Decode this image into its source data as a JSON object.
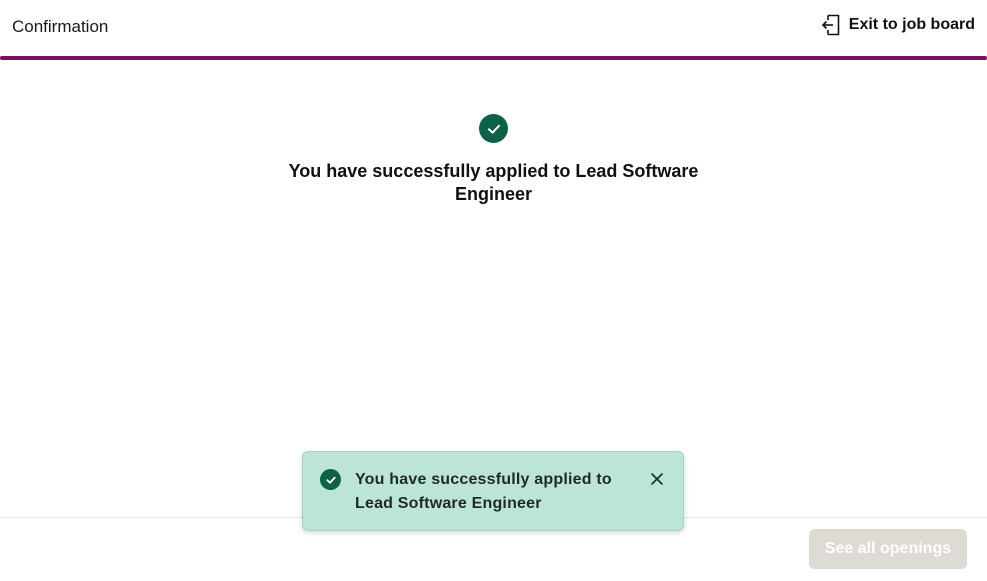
{
  "header": {
    "title": "Confirmation",
    "exit_label": "Exit to job board",
    "exit_icon": "exit-door-icon",
    "accent_color": "#7a0f63"
  },
  "main": {
    "status_icon": "check-circle-icon",
    "message": "You have successfully applied to Lead Software Engineer",
    "success_color": "#0e6149"
  },
  "toast": {
    "status_icon": "check-circle-icon",
    "message": "You have successfully applied to Lead Software Engineer",
    "close_icon": "close-icon",
    "background_color": "#bce5d8"
  },
  "footer": {
    "see_all_label": "See all openings",
    "see_all_disabled": true
  }
}
